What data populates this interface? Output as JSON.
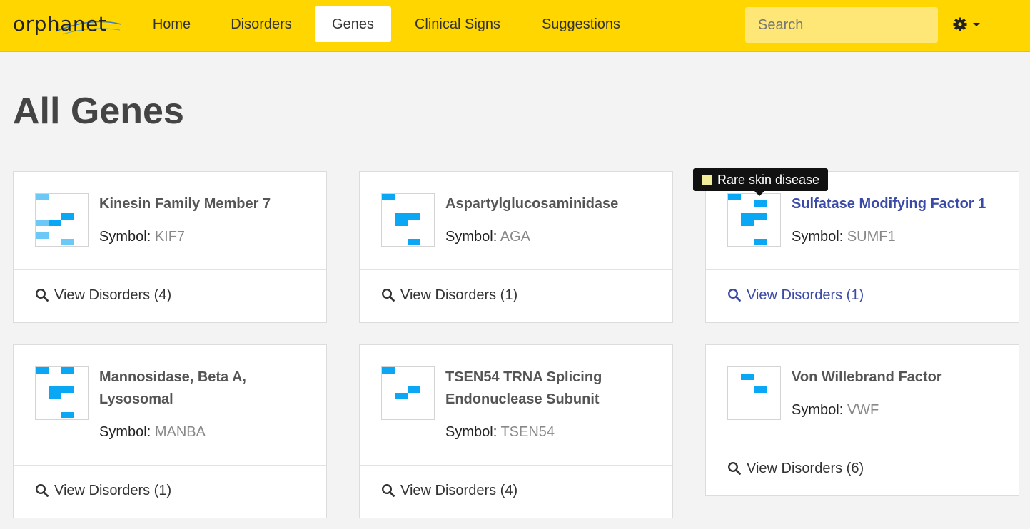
{
  "brand": {
    "text": "orphanet"
  },
  "nav": {
    "items": [
      "Home",
      "Disorders",
      "Genes",
      "Clinical Signs",
      "Suggestions"
    ],
    "active": "Genes"
  },
  "search": {
    "placeholder": "Search",
    "value": ""
  },
  "settings": {
    "icon": "gear-icon",
    "caret": "caret-down-icon"
  },
  "page": {
    "title": "All Genes"
  },
  "symbol_label": "Symbol: ",
  "cards": [
    {
      "name": "Kinesin Family Member 7",
      "symbol": "KIF7",
      "view_label": "View Disorders (4)"
    },
    {
      "name": "Aspartylglucosaminidase",
      "symbol": "AGA",
      "view_label": "View Disorders (1)"
    },
    {
      "name": "Sulfatase Modifying Factor 1",
      "symbol": "SUMF1",
      "view_label": "View Disorders (1)"
    },
    {
      "name": "Mannosidase, Beta A, Lysosomal",
      "symbol": "MANBA",
      "view_label": "View Disorders (1)"
    },
    {
      "name": "TSEN54 TRNA Splicing Endonuclease Subunit",
      "symbol": "TSEN54",
      "view_label": "View Disorders (4)"
    },
    {
      "name": "Von Willebrand Factor",
      "symbol": "VWF",
      "view_label": "View Disorders (6)"
    }
  ],
  "tooltip": {
    "text": "Rare skin disease",
    "swatch_color": "#f2ec9a"
  },
  "colors": {
    "navbar": "#ffd600",
    "accent_link": "#3b4aa6",
    "thumb_bar": "#0aa7f5",
    "thumb_bar_light": "#6cc9f7"
  }
}
